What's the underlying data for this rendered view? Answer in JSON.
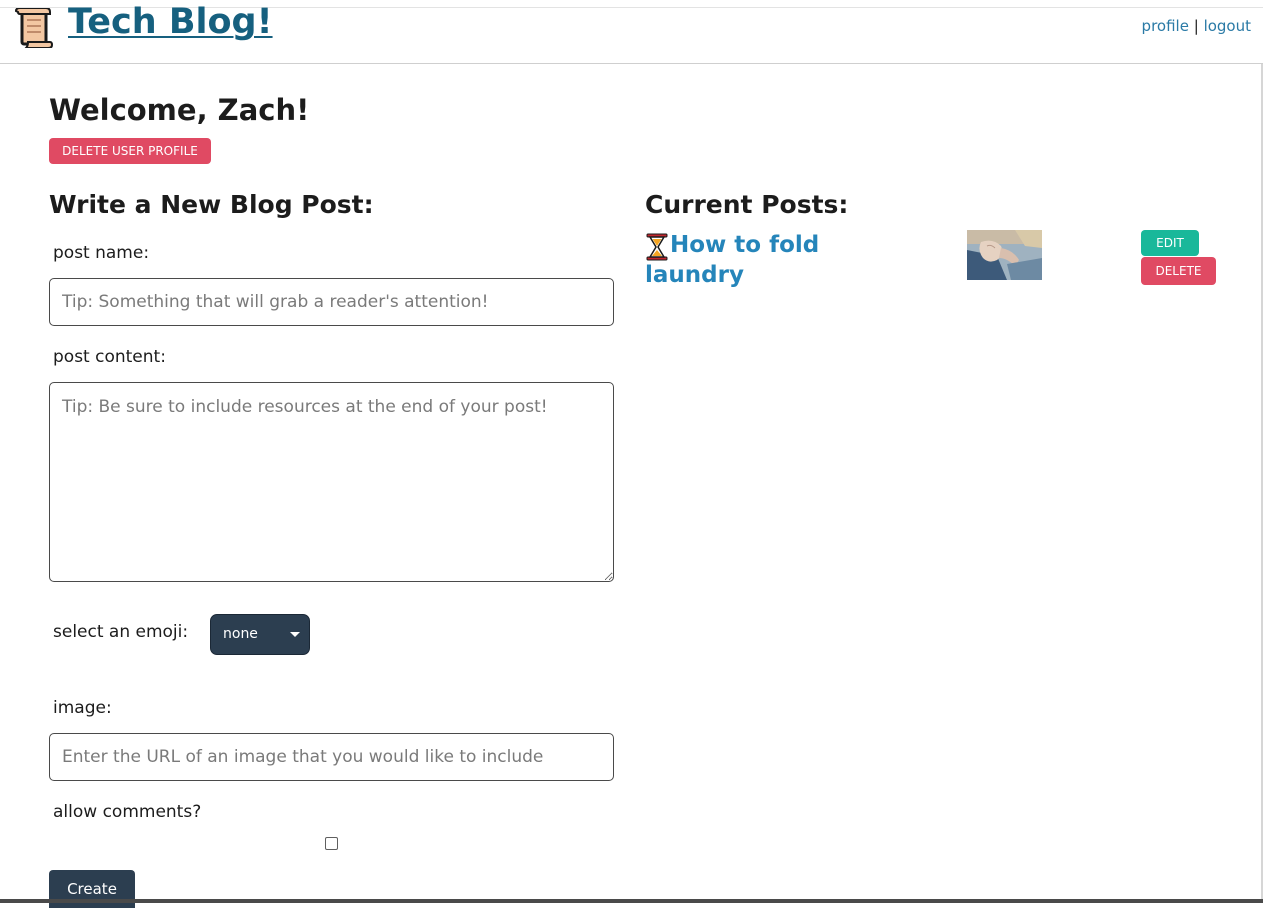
{
  "header": {
    "logo_icon": "scroll-icon",
    "site_title": "Tech Blog!",
    "nav": {
      "profile": "profile",
      "separator": "|",
      "logout": "logout"
    }
  },
  "welcome": {
    "heading": "Welcome, Zach!",
    "delete_profile_label": "DELETE USER PROFILE"
  },
  "new_post": {
    "heading": "Write a New Blog Post:",
    "post_name_label": "post name:",
    "post_name_placeholder": "Tip: Something that will grab a reader's attention!",
    "post_content_label": "post content:",
    "post_content_placeholder": "Tip: Be sure to include resources at the end of your post!",
    "emoji_label": "select an emoji:",
    "emoji_selected": "none",
    "image_label": "image:",
    "image_placeholder": "Enter the URL of an image that you would like to include",
    "comments_label": "allow comments?",
    "allow_comments_checked": false,
    "create_label": "Create"
  },
  "current_posts": {
    "heading": "Current Posts:",
    "posts": [
      {
        "emoji": "hourglass-icon",
        "title": "How to fold laundry",
        "thumbnail": "laundry-thumbnail",
        "edit_label": "EDIT",
        "delete_label": "DELETE"
      }
    ]
  },
  "colors": {
    "title": "#16607f",
    "link": "#2a7aa6",
    "post_title": "#2585ba",
    "danger": "#e04a63",
    "edit": "#19b89a",
    "dark_button": "#2c3e50"
  }
}
